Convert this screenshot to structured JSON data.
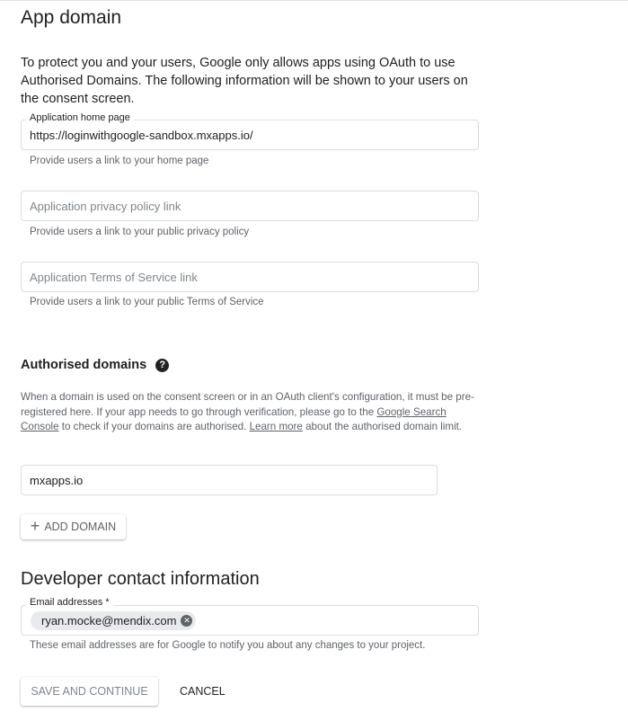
{
  "app_domain": {
    "title": "App domain",
    "description": "To protect you and your users, Google only allows apps using OAuth to use Authorised Domains. The following information will be shown to your users on the consent screen.",
    "home_page": {
      "label": "Application home page",
      "value": "https://loginwithgoogle-sandbox.mxapps.io/",
      "helper": "Provide users a link to your home page"
    },
    "privacy_policy": {
      "placeholder": "Application privacy policy link",
      "helper": "Provide users a link to your public privacy policy"
    },
    "terms_of_service": {
      "placeholder": "Application Terms of Service link",
      "helper": "Provide users a link to your public Terms of Service"
    }
  },
  "authorised_domains": {
    "title": "Authorised domains",
    "help_icon": "question-circle-icon",
    "note_part1": "When a domain is used on the consent screen or in an OAuth client's configuration, it must be pre-registered here. If your app needs to go through verification, please go to the ",
    "note_link1": "Google Search Console",
    "note_part2": " to check if your domains are authorised. ",
    "note_link2": "Learn more",
    "note_part3": " about the authorised domain limit.",
    "domains": [
      "mxapps.io"
    ],
    "add_button_icon": "plus-icon",
    "add_button": "ADD DOMAIN"
  },
  "developer_contact": {
    "title": "Developer contact information",
    "email_label": "Email addresses *",
    "emails": [
      "ryan.mocke@mendix.com"
    ],
    "chip_remove_icon": "close-circle-icon",
    "helper": "These email addresses are for Google to notify you about any changes to your project."
  },
  "actions": {
    "save": "SAVE AND CONTINUE",
    "cancel": "CANCEL"
  }
}
